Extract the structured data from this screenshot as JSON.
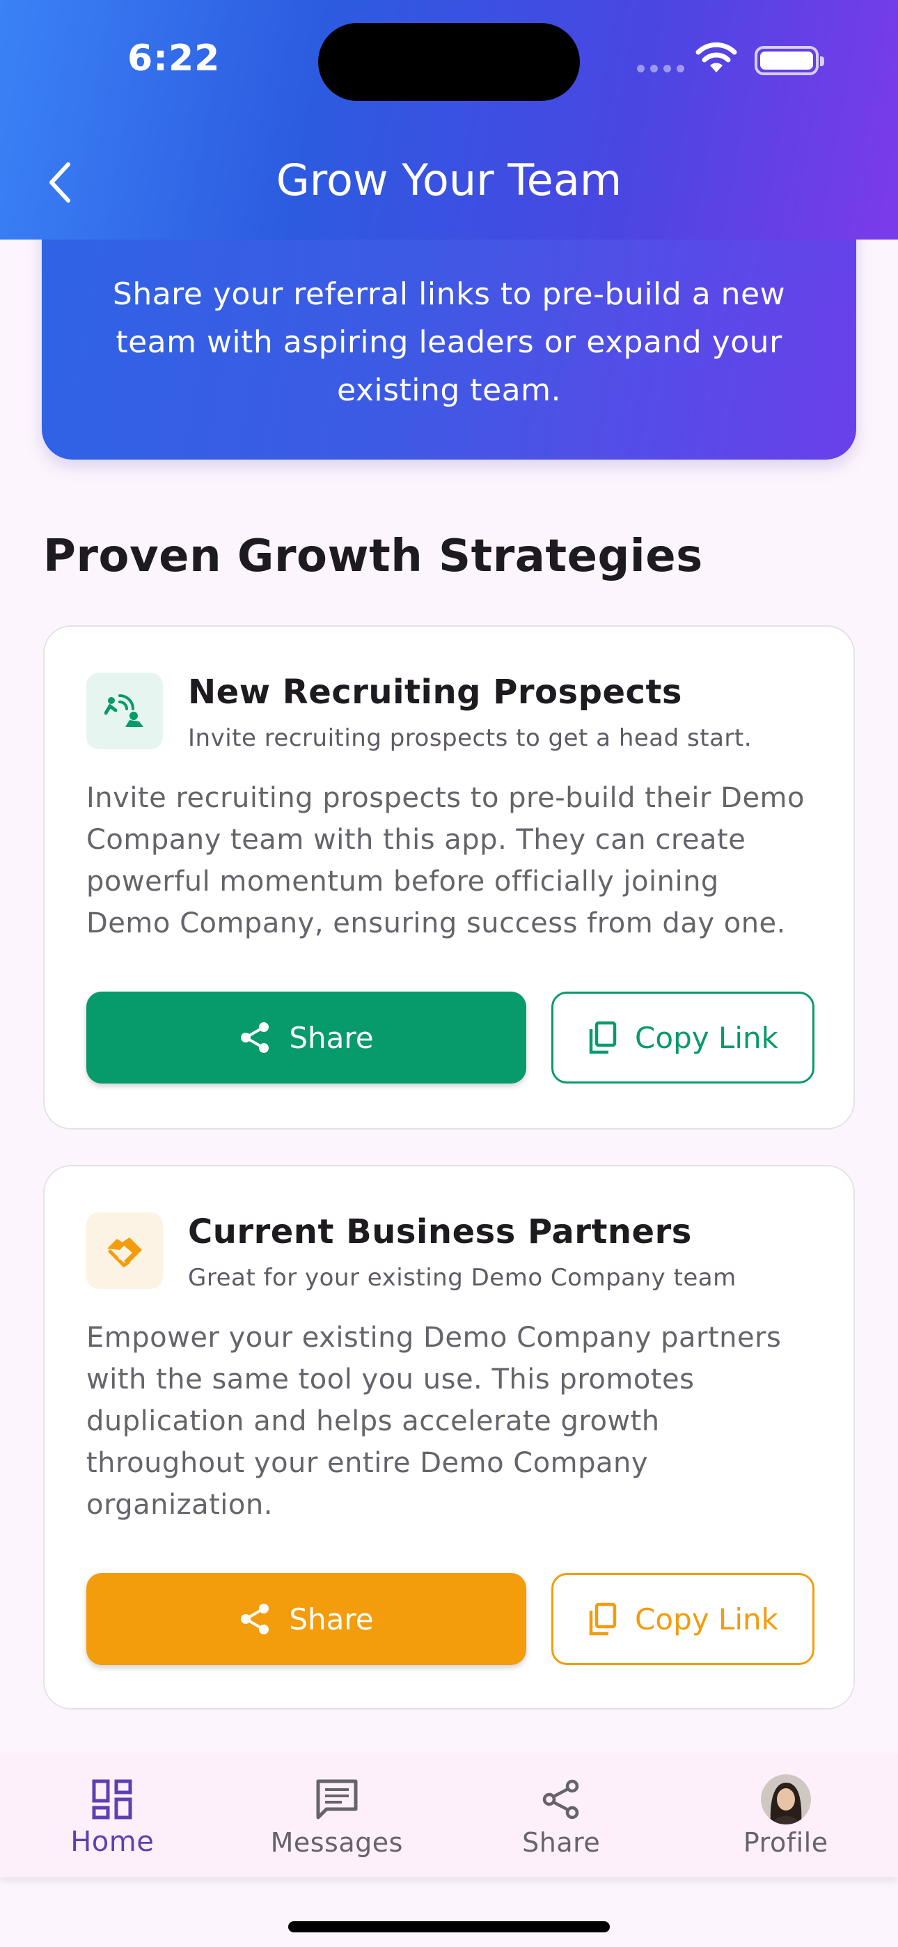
{
  "status_bar": {
    "time": "6:22"
  },
  "header": {
    "title": "Grow Your Team"
  },
  "hero": {
    "text": "Share your referral links to pre-build a new team with aspiring leaders or expand your existing team."
  },
  "section": {
    "title": "Proven Growth Strategies"
  },
  "cards": [
    {
      "title": "New Recruiting Prospects",
      "subtitle": "Invite recruiting prospects to get a head start.",
      "body": "Invite recruiting prospects to pre-build their Demo Company team with this app. They can create powerful momentum before officially joining Demo Company, ensuring success from day one.",
      "share_label": "Share",
      "copy_label": "Copy Link",
      "accent": "#079a6b",
      "icon_bg": "#e6f5ef",
      "icon": "connect-person-icon"
    },
    {
      "title": "Current Business Partners",
      "subtitle": "Great for your existing Demo Company team",
      "body": "Empower your existing Demo Company partners with the same tool you use. This promotes duplication and helps accelerate growth throughout your entire Demo Company organization.",
      "share_label": "Share",
      "copy_label": "Copy Link",
      "accent": "#f39c0c",
      "icon_bg": "#fdf3e4",
      "icon": "handshake-icon"
    }
  ],
  "nav": {
    "items": [
      {
        "label": "Home",
        "icon": "dashboard-icon",
        "active": true
      },
      {
        "label": "Messages",
        "icon": "message-icon",
        "active": false
      },
      {
        "label": "Share",
        "icon": "share-icon",
        "active": false
      },
      {
        "label": "Profile",
        "icon": "avatar",
        "active": false
      }
    ]
  },
  "colors": {
    "nav_active": "#5e3fb3",
    "header_start": "#3b82f6",
    "header_end": "#7b3be8"
  }
}
